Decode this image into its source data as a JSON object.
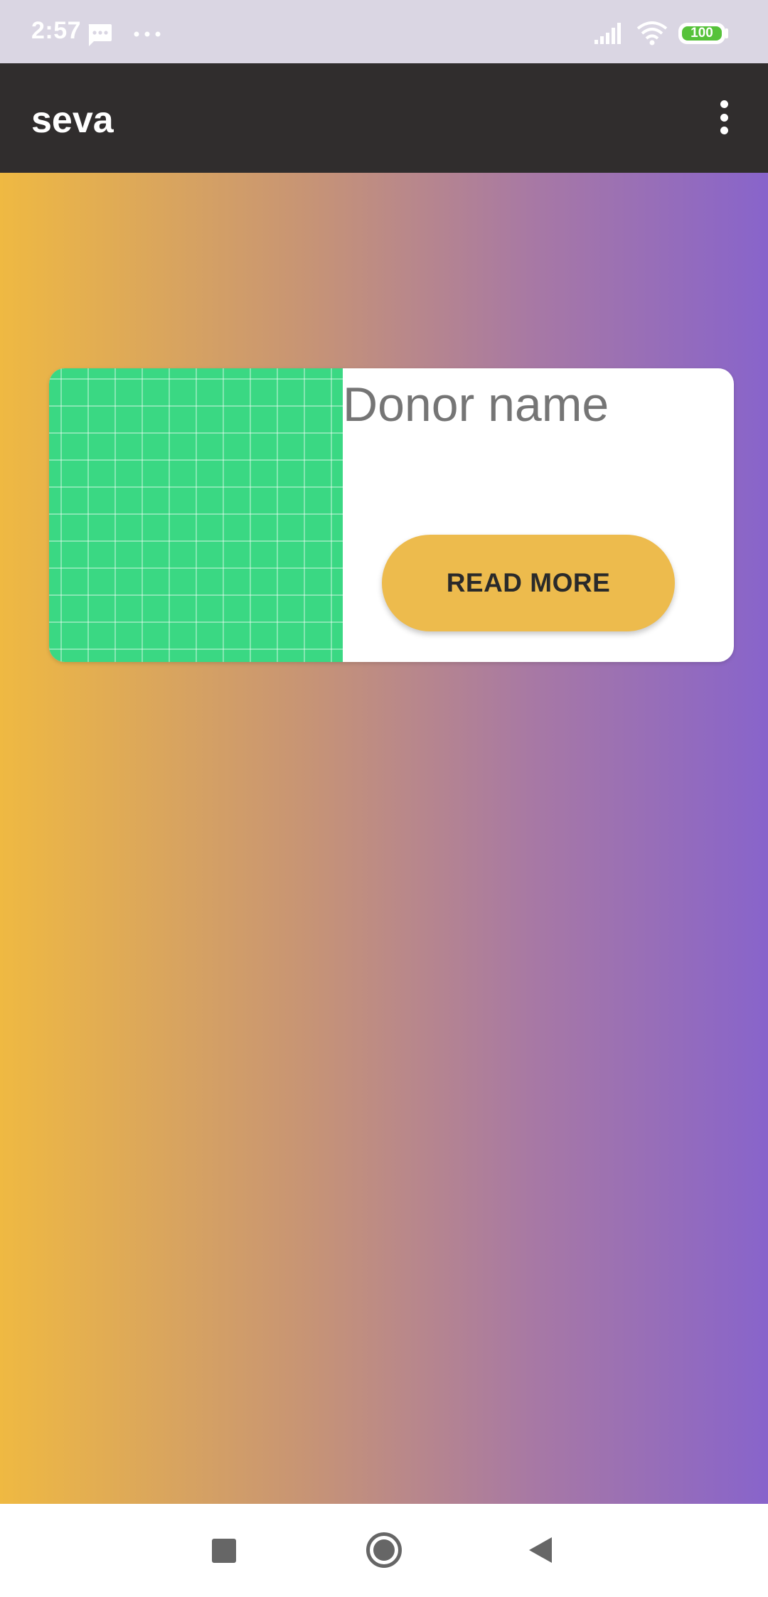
{
  "status_bar": {
    "time": "2:57",
    "battery_level": "100",
    "icons": [
      "message-icon",
      "more-dots-icon",
      "signal-icon",
      "wifi-icon",
      "battery-icon"
    ]
  },
  "app_bar": {
    "title": "seva",
    "menu_icon": "overflow-menu-icon"
  },
  "theme": {
    "gradient_start": "#efb942",
    "gradient_end": "#8864cb",
    "app_bar_color": "#302d2d",
    "button_color": "#edbb4d",
    "image_color": "#3ad883"
  },
  "card": {
    "image_icon": "grid-image",
    "donor_name": "Donor name",
    "button_label": "READ MORE"
  },
  "nav_bar": {
    "icons": [
      "recents-icon",
      "home-icon",
      "back-icon"
    ]
  }
}
